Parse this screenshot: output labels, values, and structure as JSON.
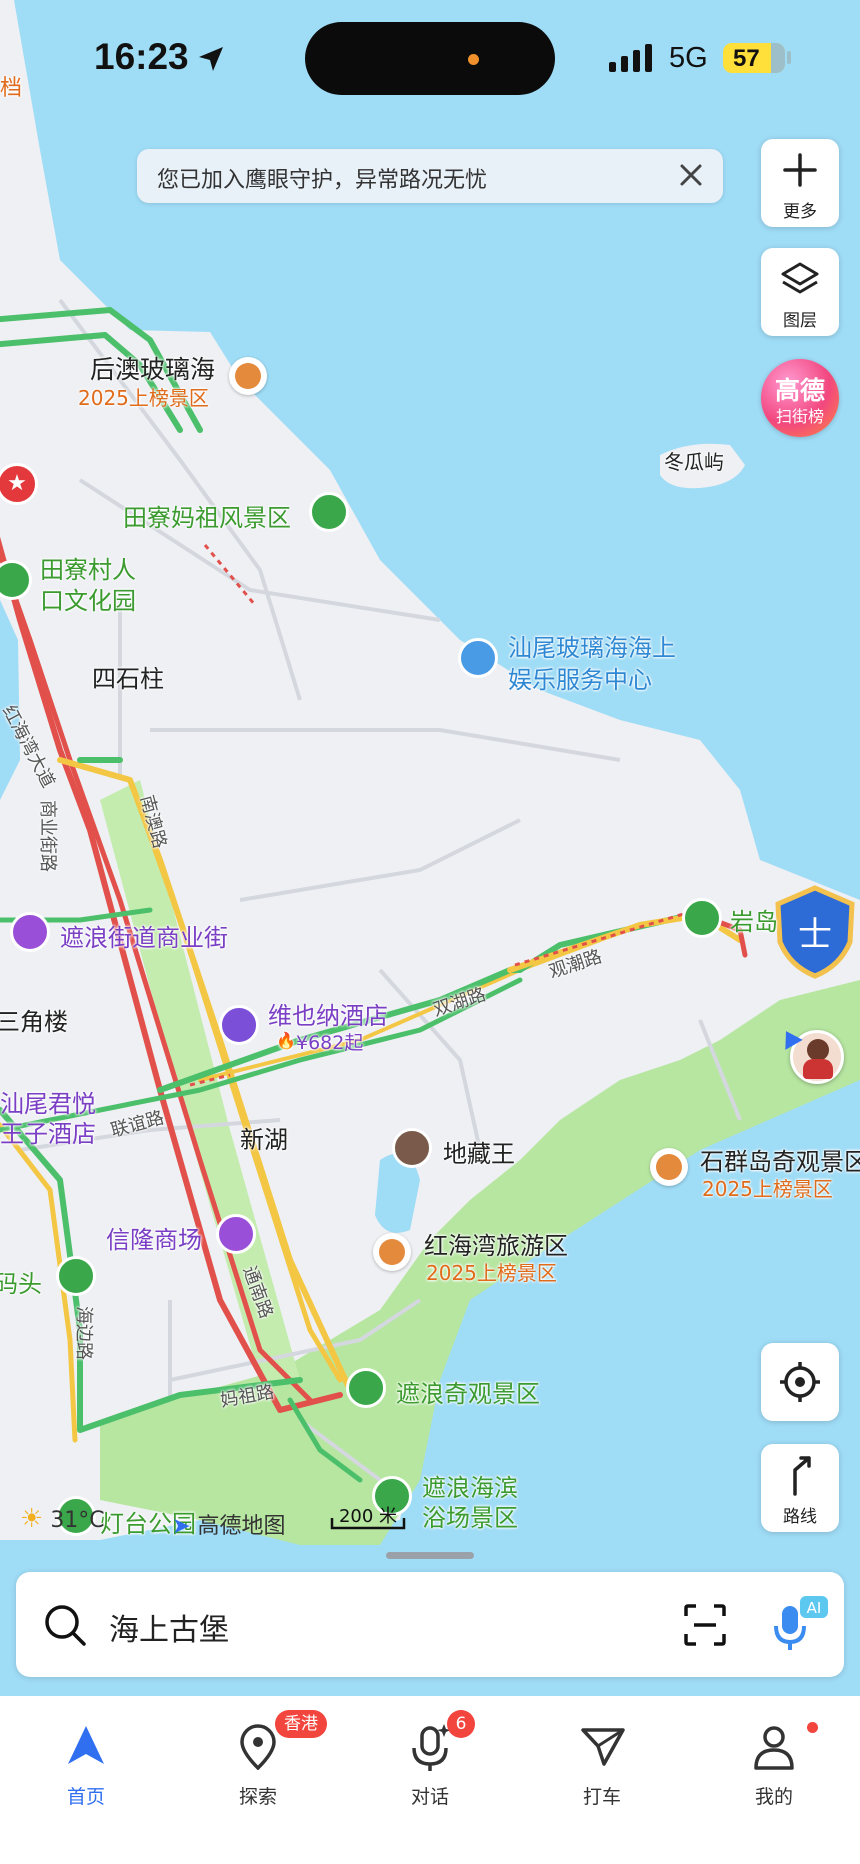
{
  "status_bar": {
    "time": "16:23",
    "network": "5G",
    "battery": "57",
    "corner_label": "档"
  },
  "notice": {
    "text": "您已加入鹰眼守护，异常路况无忧"
  },
  "right_buttons": {
    "more": "更多",
    "layers": "图层",
    "gaode_top": "高德",
    "gaode_bottom": "扫街榜",
    "route": "路线"
  },
  "map_labels": {
    "houao": "后澳玻璃海",
    "houao_rank": "2025上榜景区",
    "dongguayu": "冬瓜屿",
    "tianliao_mazu": "田寮妈祖风景区",
    "tianliao_village_1": "田寮村人",
    "tianliao_village_2": "口文化园",
    "sishizhu": "四石柱",
    "glass_sea_1": "汕尾玻璃海海上",
    "glass_sea_2": "娱乐服务中心",
    "honghai_ave": "红海湾大道",
    "commercial_st": "商业街路",
    "nanao_rd": "南澳路",
    "zhelang_street": "遮浪街道商业街",
    "yan_partial": "岩岛",
    "shuangchao_rd_1": "观潮路",
    "shuangchao_rd_2": "双湖路",
    "vienna_hotel": "维也纳酒店",
    "vienna_price": "¥682起",
    "sanjiaolou": "三角楼",
    "junyue_1": "汕尾君悦",
    "junyue_2": "王子酒店",
    "lianyi_rd": "联谊路",
    "xinhu": "新湖",
    "dizangwang": "地藏王",
    "shiqundao": "石群岛奇观景区",
    "shiqundao_rank": "2025上榜景区",
    "xinlong_mall": "信隆商场",
    "honghaiwan": "红海湾旅游区",
    "honghaiwan_rank": "2025上榜景区",
    "matou": "码头",
    "haibian_rd": "海边路",
    "tongnan_rd": "通南路",
    "mazu_rd": "妈祖路",
    "zhelang_wonder": "遮浪奇观景区",
    "beach_1": "遮浪海滨",
    "beach_2": "浴场景区",
    "lighthouse": "灯台公园"
  },
  "weather": "31°C",
  "map_brand": "高德地图",
  "scale": "200 米",
  "search": {
    "query": "海上古堡"
  },
  "tabs": [
    {
      "label": "首页",
      "active": true
    },
    {
      "label": "探索",
      "badge": "香港"
    },
    {
      "label": "对话",
      "badge": "6"
    },
    {
      "label": "打车"
    },
    {
      "label": "我的"
    }
  ],
  "colors": {
    "accent": "#2f6ff0",
    "sea": "#9fdcf6",
    "land": "#eef0f4",
    "park": "#b7e6a1",
    "road_red": "#e2504b",
    "road_yellow": "#f3c744",
    "road_green": "#4cbf6b"
  }
}
